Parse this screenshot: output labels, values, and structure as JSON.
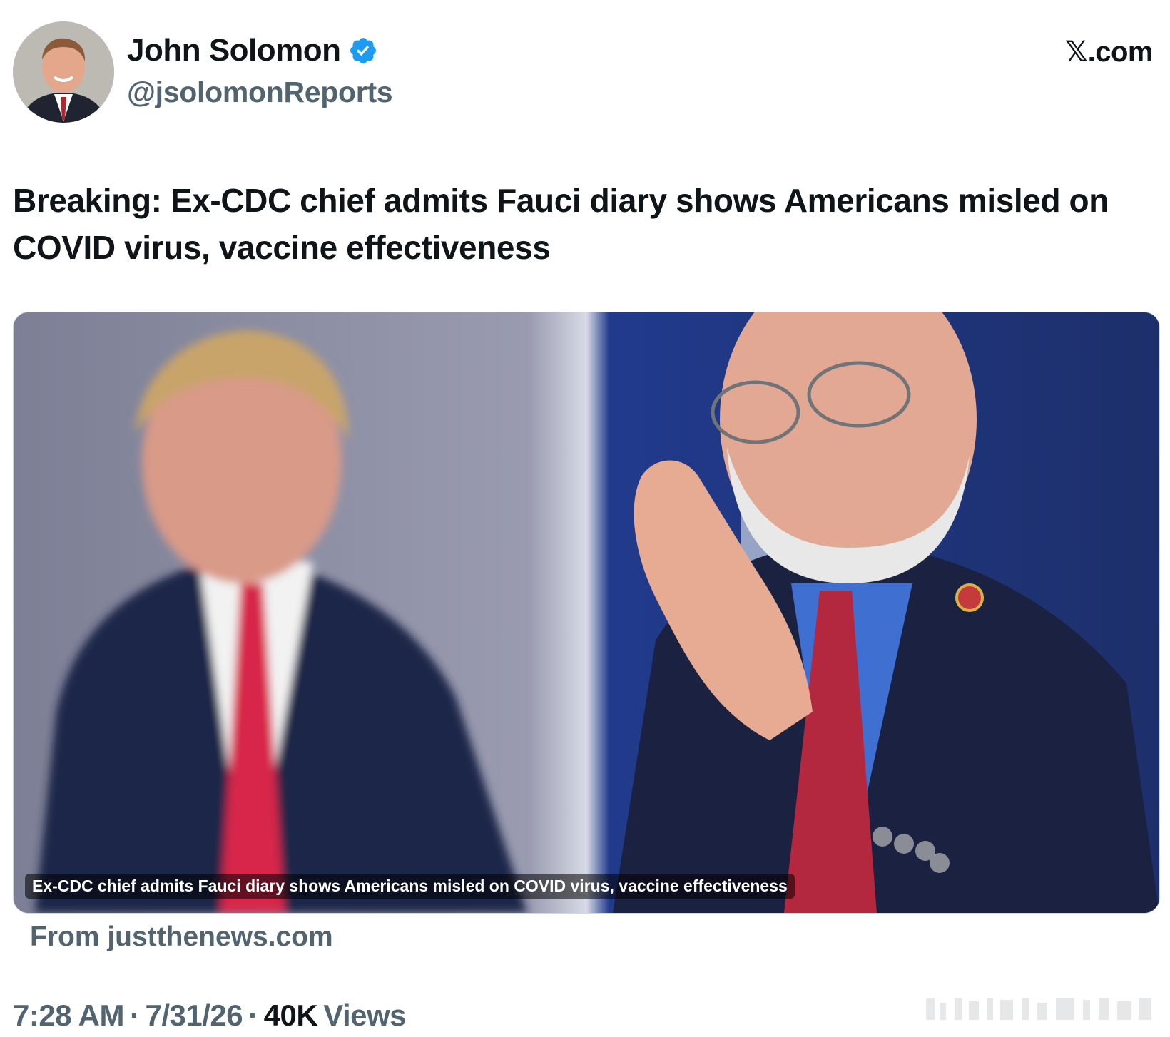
{
  "author": {
    "display_name": "John Solomon",
    "handle": "@jsolomonReports",
    "verified": true
  },
  "brand": "𝕏.com",
  "tweet": {
    "text": "Breaking: Ex-CDC chief admits Fauci diary shows Americans misled on COVID virus, vaccine effectiveness"
  },
  "card": {
    "caption": "Ex-CDC chief admits Fauci diary shows Americans misled on COVID virus, vaccine effectiveness",
    "source": "From justthenews.com"
  },
  "meta": {
    "time": "7:28 AM",
    "separator1": "·",
    "date": "7/31/26",
    "separator2": "·",
    "views_count": "40K",
    "views_label": "Views"
  },
  "colors": {
    "verified_badge": "#1d9bf0",
    "secondary_text": "#536471",
    "primary_text": "#0f1419"
  },
  "icons": {
    "verified": "verified-badge-icon",
    "avatar": "profile-avatar"
  }
}
